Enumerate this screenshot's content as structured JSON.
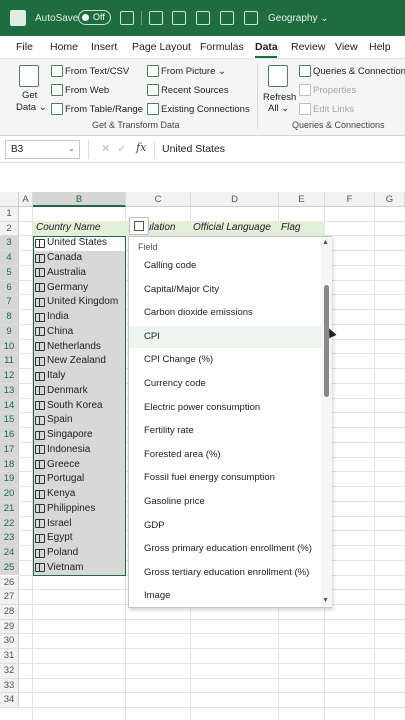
{
  "titlebar": {
    "autosave_label": "AutoSave",
    "autosave_state": "Off",
    "doc_title": "Geography ⌄"
  },
  "ribbon_tabs": [
    "File",
    "Home",
    "Insert",
    "Page Layout",
    "Formulas",
    "Data",
    "Review",
    "View",
    "Help"
  ],
  "active_tab": "Data",
  "ribbon": {
    "get_data": "Get",
    "get_data_2": "Data ⌄",
    "from_text_csv": "From Text/CSV",
    "from_web": "From Web",
    "from_table_range": "From Table/Range",
    "from_picture": "From Picture ⌄",
    "recent_sources": "Recent Sources",
    "existing_connections": "Existing Connections",
    "group_get_transform": "Get & Transform Data",
    "refresh": "Refresh",
    "refresh_all": "All ⌄",
    "queries_connections": "Queries & Connections",
    "properties": "Properties",
    "edit_links": "Edit Links",
    "group_queries": "Queries & Connections"
  },
  "formula_bar": {
    "name_box": "B3",
    "cancel": "✕",
    "enter": "✓",
    "fx": "fx",
    "value": "United States"
  },
  "columns": [
    "A",
    "B",
    "C",
    "D",
    "E",
    "F",
    "G"
  ],
  "rows": [
    "1",
    "2",
    "3",
    "4",
    "5",
    "6",
    "7",
    "8",
    "9",
    "10",
    "11",
    "12",
    "13",
    "14",
    "15",
    "16",
    "17",
    "18",
    "19",
    "20",
    "21",
    "22",
    "23",
    "24",
    "25",
    "26",
    "27",
    "28",
    "29",
    "30",
    "31",
    "32",
    "33",
    "34"
  ],
  "table_headers": {
    "country_name": "Country Name",
    "population": "ulation",
    "official_language": "Official Language",
    "flag": "Flag"
  },
  "countries": [
    "United States",
    "Canada",
    "Australia",
    "Germany",
    "United Kingdom",
    "India",
    "China",
    "Netherlands",
    "New Zealand",
    "Italy",
    "Denmark",
    "South Korea",
    "Spain",
    "Singapore",
    "Indonesia",
    "Greece",
    "Portugal",
    "Kenya",
    "Philippines",
    "Israel",
    "Egypt",
    "Poland",
    "Vietnam"
  ],
  "field_panel": {
    "header": "Field",
    "fields": [
      "Calling code",
      "Capital/Major City",
      "Carbon dioxide emissions",
      "CPI",
      "CPI Change (%)",
      "Currency code",
      "Electric power consumption",
      "Fertility rate",
      "Forested area (%)",
      "Fossil fuel energy consumption",
      "Gasoline price",
      "GDP",
      "Gross primary education enrollment (%)",
      "Gross tertiary education enrollment (%)",
      "Image"
    ],
    "hovered": "CPI"
  },
  "colors": {
    "accent": "#1e6c3f",
    "table_header_bg": "#e2efda",
    "selection_bg": "#d8d8d8"
  }
}
